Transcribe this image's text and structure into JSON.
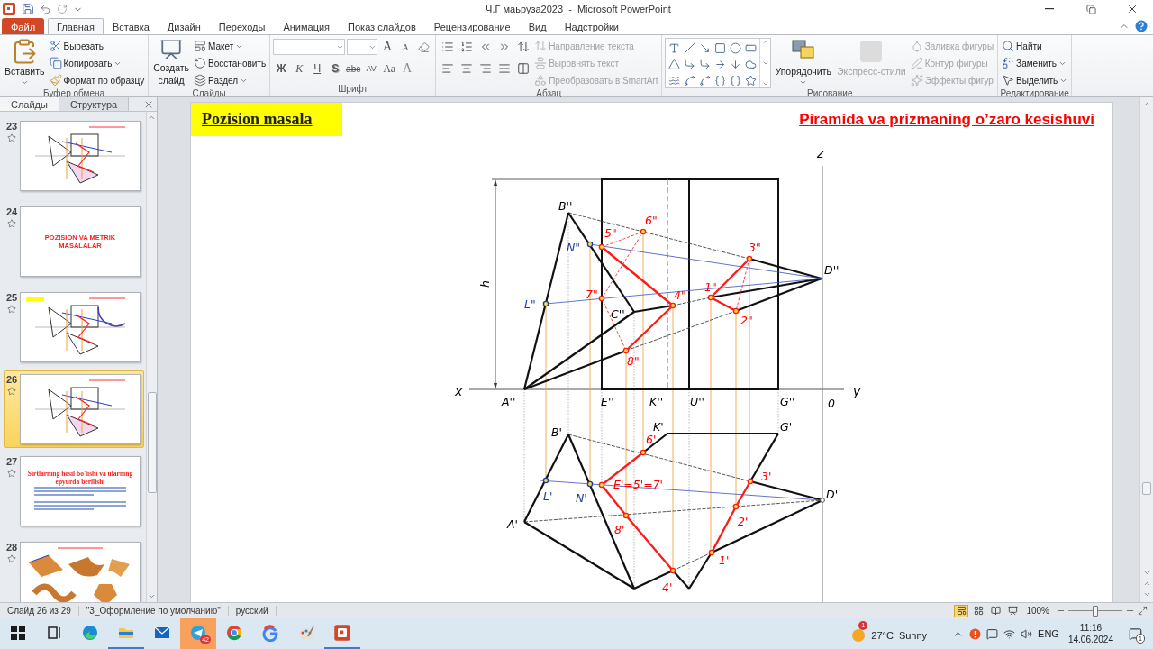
{
  "titlebar": {
    "title": "Ч.Г маьруза2023  -  Microsoft PowerPoint"
  },
  "tabs": [
    {
      "label": "Файл",
      "kind": "file",
      "selected": false
    },
    {
      "label": "Главная",
      "kind": "tab",
      "selected": true
    },
    {
      "label": "Вставка",
      "kind": "tab",
      "selected": false
    },
    {
      "label": "Дизайн",
      "kind": "tab",
      "selected": false
    },
    {
      "label": "Переходы",
      "kind": "tab",
      "selected": false
    },
    {
      "label": "Анимация",
      "kind": "tab",
      "selected": false
    },
    {
      "label": "Показ слайдов",
      "kind": "tab",
      "selected": false
    },
    {
      "label": "Рецензирование",
      "kind": "tab",
      "selected": false
    },
    {
      "label": "Вид",
      "kind": "tab",
      "selected": false
    },
    {
      "label": "Надстройки",
      "kind": "tab",
      "selected": false
    }
  ],
  "clipboard": {
    "label": "Буфер обмена",
    "paste": "Вставить",
    "items": [
      {
        "label": "Вырезать",
        "dropdown": false
      },
      {
        "label": "Копировать",
        "dropdown": true
      },
      {
        "label": "Формат по образцу",
        "dropdown": false
      }
    ]
  },
  "slides_group": {
    "label": "Слайды",
    "new_slide": [
      "Создать",
      "слайд"
    ],
    "items": [
      {
        "label": "Макет",
        "dropdown": true
      },
      {
        "label": "Восстановить",
        "dropdown": false
      },
      {
        "label": "Раздел",
        "dropdown": true
      }
    ]
  },
  "font": {
    "label": "Шрифт",
    "grow": "A",
    "shrink": "A",
    "styles": [
      "Ж",
      "К",
      "Ч",
      "S",
      "abc",
      "AV",
      "Aa",
      "A"
    ]
  },
  "paragraph": {
    "label": "Абзац",
    "items": [
      {
        "label": "Направление текста",
        "disabled": true
      },
      {
        "label": "Выровнять текст",
        "disabled": true
      },
      {
        "label": "Преобразовать в SmartArt",
        "disabled": true
      }
    ]
  },
  "drawing": {
    "label": "Рисование",
    "arrange": "Упорядочить",
    "quick_styles": {
      "label": "Экспресс-стили",
      "disabled": true
    },
    "items": [
      {
        "label": "Заливка фигуры",
        "disabled": true
      },
      {
        "label": "Контур фигуры",
        "disabled": true
      },
      {
        "label": "Эффекты фигур",
        "disabled": true
      }
    ]
  },
  "editing": {
    "label": "Редактирование",
    "items": [
      {
        "label": "Найти",
        "dropdown": false
      },
      {
        "label": "Заменить",
        "dropdown": true
      },
      {
        "label": "Выделить",
        "dropdown": true
      }
    ]
  },
  "slide_panel": {
    "tabs": [
      {
        "label": "Слайды",
        "selected": true
      },
      {
        "label": "Структура",
        "selected": false
      }
    ],
    "slides": [
      {
        "number": "23",
        "kind": "diagram",
        "selected": false
      },
      {
        "number": "24",
        "kind": "title",
        "title": "POZISION  VA  METRIK MASALALAR",
        "selected": false
      },
      {
        "number": "25",
        "kind": "diagram",
        "selected": false
      },
      {
        "number": "26",
        "kind": "diagram",
        "selected": true
      },
      {
        "number": "27",
        "kind": "text",
        "title": "Sirtlarning hosil bo'lishi va ularning epyurda berilishi",
        "selected": false
      },
      {
        "number": "28",
        "kind": "surfaces",
        "selected": false
      }
    ]
  },
  "slide": {
    "heading": "Pozision masala",
    "title": "Piramida va prizmaning o’zaro kesishuvi",
    "labels": [
      {
        "text": "z",
        "color": "#000000"
      },
      {
        "text": "B''",
        "color": "#000000"
      },
      {
        "text": "6\"",
        "color": "#ff0000"
      },
      {
        "text": "5\"",
        "color": "#ff0000"
      },
      {
        "text": "N\"",
        "color": "#1f3f9f"
      },
      {
        "text": "3\"",
        "color": "#ff0000"
      },
      {
        "text": "D''",
        "color": "#000000"
      },
      {
        "text": "h",
        "color": "#000000"
      },
      {
        "text": "7\"",
        "color": "#ff0000"
      },
      {
        "text": "4\"",
        "color": "#ff0000"
      },
      {
        "text": "1\"",
        "color": "#ff0000"
      },
      {
        "text": "L\"",
        "color": "#1f3f9f"
      },
      {
        "text": "C''",
        "color": "#000000"
      },
      {
        "text": "2\"",
        "color": "#ff0000"
      },
      {
        "text": "8\"",
        "color": "#ff0000"
      },
      {
        "text": "x",
        "color": "#000000"
      },
      {
        "text": "y",
        "color": "#000000"
      },
      {
        "text": "A''",
        "color": "#000000"
      },
      {
        "text": "E''",
        "color": "#000000"
      },
      {
        "text": "K''",
        "color": "#000000"
      },
      {
        "text": "U''",
        "color": "#000000"
      },
      {
        "text": "G''",
        "color": "#000000"
      },
      {
        "text": "0",
        "color": "#000000"
      },
      {
        "text": "K'",
        "color": "#000000"
      },
      {
        "text": "B'",
        "color": "#000000"
      },
      {
        "text": "G'",
        "color": "#000000"
      },
      {
        "text": "6'",
        "color": "#ff0000"
      },
      {
        "text": "3'",
        "color": "#ff0000"
      },
      {
        "text": "L'",
        "color": "#1f3f9f"
      },
      {
        "text": "N'",
        "color": "#1f3f9f"
      },
      {
        "text": "E'=5'=7'",
        "color": "#ff0000"
      },
      {
        "text": "D'",
        "color": "#000000"
      },
      {
        "text": "A'",
        "color": "#000000"
      },
      {
        "text": "2'",
        "color": "#ff0000"
      },
      {
        "text": "8'",
        "color": "#ff0000"
      },
      {
        "text": "1'",
        "color": "#ff0000"
      },
      {
        "text": "4'",
        "color": "#ff0000"
      }
    ]
  },
  "status_bar": {
    "slide": "Слайд 26 из 29",
    "theme": "\"3_Оформление по умолчанию\"",
    "language": "русский",
    "views": [
      {
        "kind": "normal",
        "selected": true
      },
      {
        "kind": "sorter",
        "selected": false
      },
      {
        "kind": "reading",
        "selected": false
      },
      {
        "kind": "show",
        "selected": false
      }
    ],
    "zoom": "100%",
    "zoom_slider": {
      "level": 0.5
    }
  },
  "taskbar": {
    "apps": [
      {
        "kind": "start",
        "running": false,
        "flashing": false
      },
      {
        "kind": "taskview",
        "running": false,
        "flashing": false
      },
      {
        "kind": "edge",
        "running": false,
        "flashing": false
      },
      {
        "kind": "explorer",
        "running": true,
        "flashing": false
      },
      {
        "kind": "mail",
        "running": false,
        "flashing": false
      },
      {
        "kind": "telegram",
        "running": false,
        "flashing": true,
        "badge": "42"
      },
      {
        "kind": "chrome",
        "running": false,
        "flashing": false
      },
      {
        "kind": "google",
        "running": false,
        "flashing": false
      },
      {
        "kind": "paint",
        "running": false,
        "flashing": false
      },
      {
        "kind": "powerpoint",
        "running": true,
        "flashing": false
      }
    ],
    "weather": {
      "badge": "1",
      "temperature": "27°C",
      "condition": "Sunny"
    },
    "language": "ENG",
    "time": "11:16",
    "date": "14.06.2024",
    "notifications": "1"
  }
}
